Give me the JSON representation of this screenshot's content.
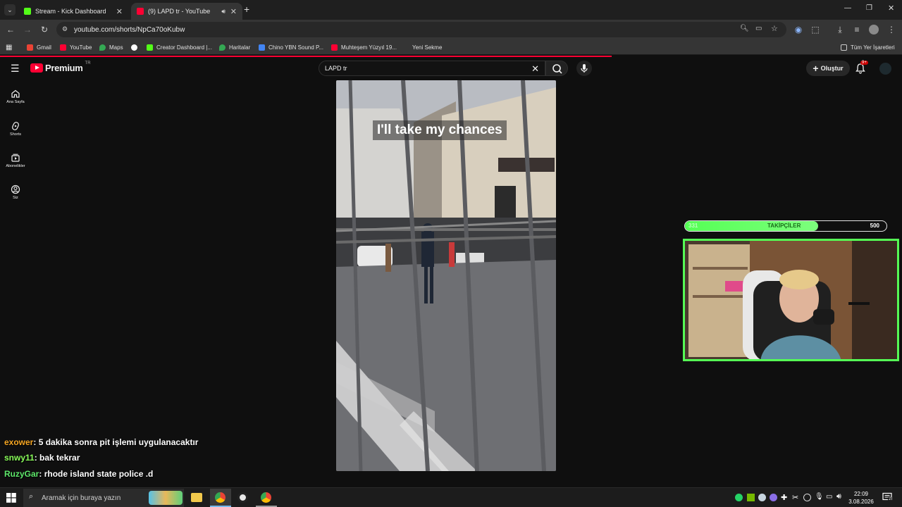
{
  "browser": {
    "tabs": [
      {
        "title": "Stream - Kick Dashboard",
        "color": "#53fc18"
      },
      {
        "title": "(9) LAPD tr - YouTube",
        "color": "#ff0033"
      }
    ],
    "url": "youtube.com/shorts/NpCa70oKubw",
    "bookmarks": [
      {
        "label": "Gmail",
        "color": "#ea4335"
      },
      {
        "label": "YouTube",
        "color": "#ff0033"
      },
      {
        "label": "Maps",
        "color": "#34a853"
      },
      {
        "label": "",
        "color": "#ffffff"
      },
      {
        "label": "Creator Dashboard |...",
        "color": "#53fc18"
      },
      {
        "label": "Haritalar",
        "color": "#34a853"
      },
      {
        "label": "Chino YBN Sound P...",
        "color": "#4285f4"
      },
      {
        "label": "Muhteşem Yüzyıl 19...",
        "color": "#ff0033"
      },
      {
        "label": "Yeni Sekme",
        "color": ""
      }
    ],
    "all_bookmarks": "Tüm Yer İşaretleri"
  },
  "youtube": {
    "logo": "Premium",
    "region": "TR",
    "search_value": "LAPD tr",
    "create_label": "Oluştur",
    "notification_count": "9+",
    "sidebar": [
      {
        "label": "Ana Sayfa",
        "icon": "home-icon"
      },
      {
        "label": "Shorts",
        "icon": "shorts-icon"
      },
      {
        "label": "Abonelikler",
        "icon": "subscriptions-icon"
      },
      {
        "label": "Siz",
        "icon": "you-icon"
      }
    ],
    "video_caption": "I'll take my chances"
  },
  "overlay": {
    "followers_current": "331",
    "followers_label": "TAKİPÇİLER",
    "followers_goal": "500",
    "followers_fraction": 0.662,
    "accent": "#55ff55"
  },
  "chat": [
    {
      "user": "exower",
      "color": "#f5a623",
      "message": ": 5 dakika sonra pit işlemi uygulanacaktır"
    },
    {
      "user": "snwy11",
      "color": "#8aff5a",
      "message": ": bak tekrar"
    },
    {
      "user": "RuzyGar",
      "color": "#5ee86b",
      "message": ": rhode island state police .d"
    }
  ],
  "taskbar": {
    "search_placeholder": "Aramak için buraya yazın",
    "time": "22:09",
    "date": "3.08.2026",
    "notif_count": "2"
  }
}
